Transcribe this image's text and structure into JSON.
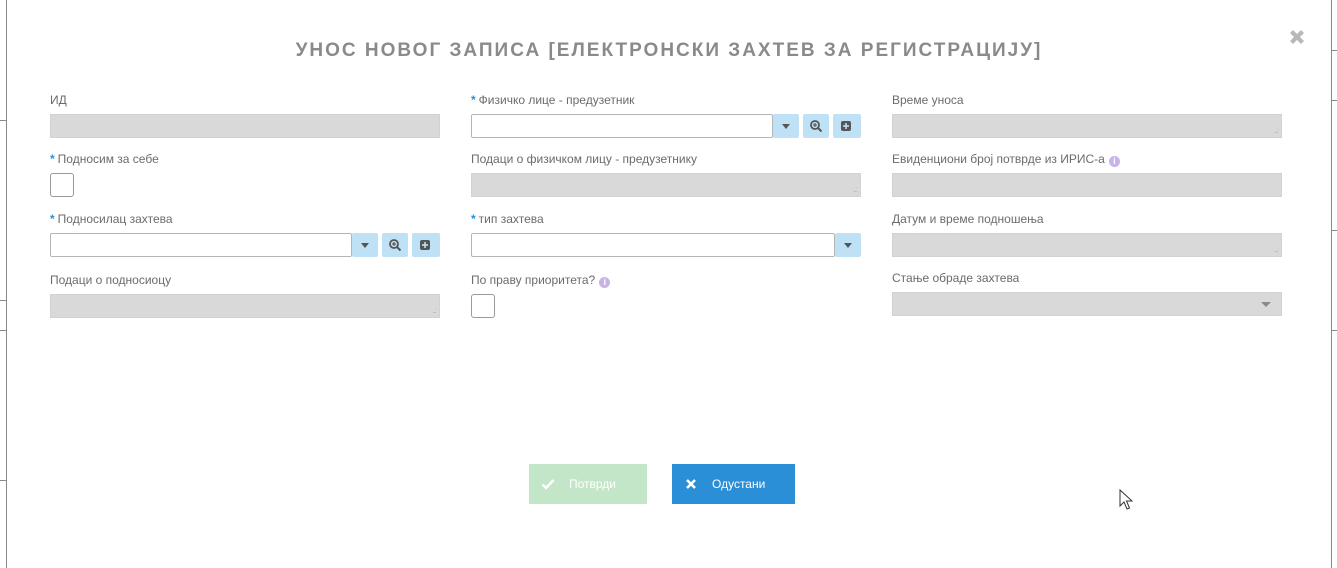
{
  "dialog": {
    "title": "УНОС НОВОГ ЗАПИСА [ЕЛЕКТРОНСКИ ЗАХТЕВ ЗА РЕГИСТРАЦИЈУ]"
  },
  "fields": {
    "id": {
      "label": "ИД"
    },
    "submit_for_self": {
      "label": "Подносим за себе",
      "required": "*"
    },
    "applicant": {
      "label": "Подносилац захтева",
      "required": "*"
    },
    "applicant_data": {
      "label": "Подаци о подносиоцу"
    },
    "natural_person_entrepreneur": {
      "label": "Физичко лице - предузетник",
      "required": "*"
    },
    "natural_person_data": {
      "label": "Подаци о физичком лицу - предузетнику"
    },
    "request_type": {
      "label": "тип захтева",
      "required": "*"
    },
    "priority_right": {
      "label": "По праву приоритета?"
    },
    "entry_time": {
      "label": "Време уноса"
    },
    "iris_confirmation_number": {
      "label": "Евиденциони број потврде из ИРИС-а"
    },
    "submission_datetime": {
      "label": "Датум и време подношења"
    },
    "processing_state": {
      "label": "Стање обраде захтева"
    }
  },
  "info_icon_glyph": "i",
  "buttons": {
    "confirm": "Потврди",
    "cancel": "Одустани"
  },
  "colors": {
    "title": "#8a8a8a",
    "required_marker": "#2d8fd8",
    "readonly_field": "#d9d9d9",
    "combo_button": "#bfe1f6",
    "confirm_disabled": "#c4e6c8",
    "cancel": "#2b8fd8",
    "info_icon": "#c9b3e6"
  },
  "icons": {
    "close": "close-icon",
    "dropdown": "chevron-down-icon",
    "search": "zoom-icon",
    "add": "plus-square-icon",
    "confirm": "check-icon",
    "cancel": "x-icon",
    "info": "info-icon"
  }
}
